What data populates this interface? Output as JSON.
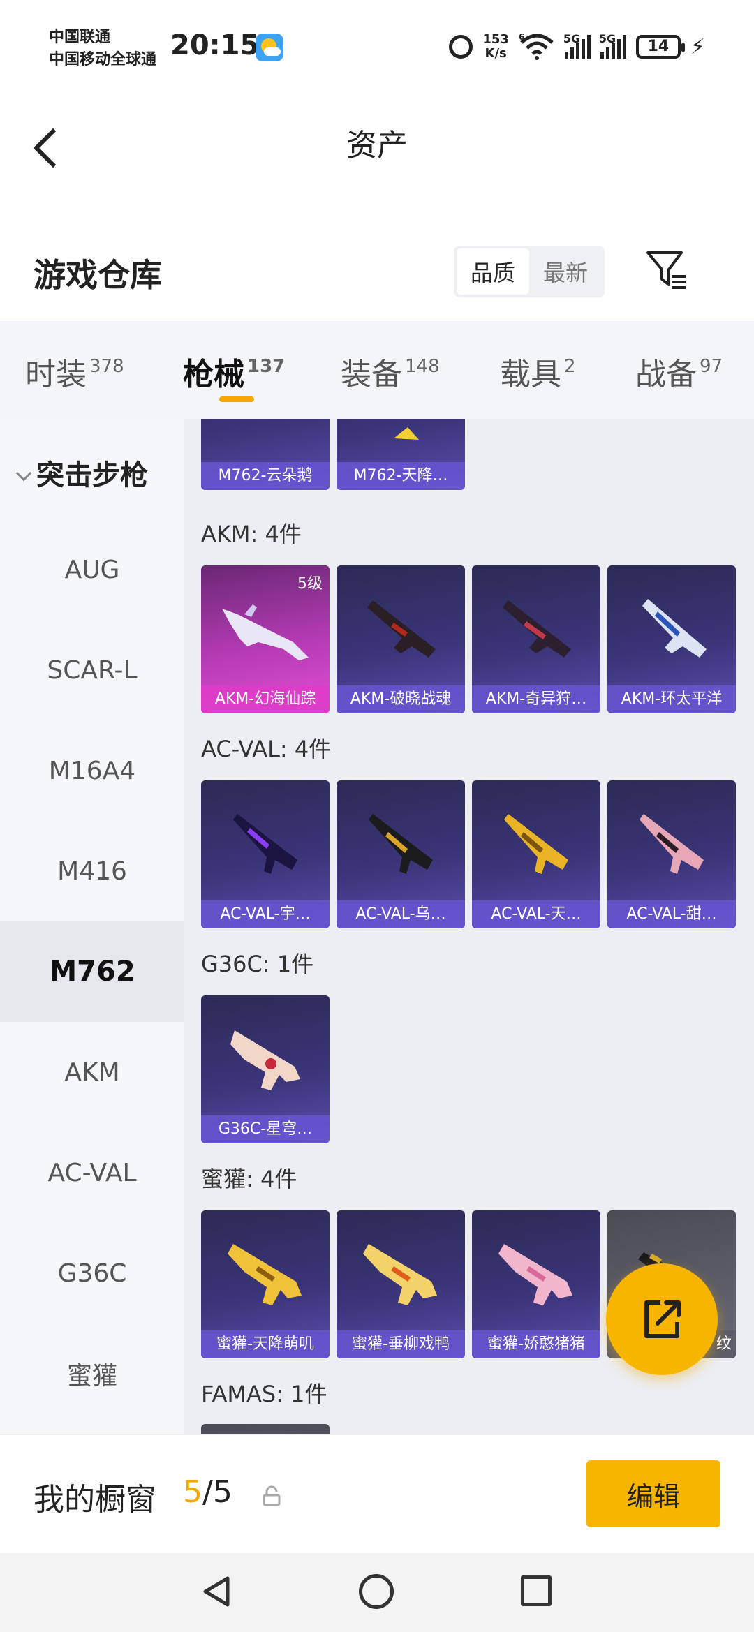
{
  "status_bar": {
    "carrier1": "中国联通",
    "carrier2": "中国移动全球通",
    "time": "20:15",
    "net_speed_value": "153",
    "net_speed_unit": "K/s",
    "signal1_label": "5G",
    "signal2_label": "5G",
    "battery": "14",
    "wifi_tag": "6"
  },
  "header": {
    "title": "资产"
  },
  "warehouse": {
    "title": "游戏仓库",
    "sort_options": [
      "品质",
      "最新"
    ],
    "sort_active": "品质"
  },
  "tabs": [
    {
      "label": "时装",
      "count": "378"
    },
    {
      "label": "枪械",
      "count": "137",
      "active": true
    },
    {
      "label": "装备",
      "count": "148"
    },
    {
      "label": "载具",
      "count": "2"
    },
    {
      "label": "战备",
      "count": "97"
    }
  ],
  "subcategory": {
    "group": "突击步枪",
    "items": [
      "AUG",
      "SCAR-L",
      "M16A4",
      "M416",
      "M762",
      "AKM",
      "AC-VAL",
      "G36C",
      "蜜獾"
    ],
    "active": "M762"
  },
  "sections": [
    {
      "title": "",
      "items": [
        "M762-云朵鹅",
        "M762-天降…"
      ]
    },
    {
      "title": "AKM: 4件",
      "items": [
        "AKM-幻海仙踪",
        "AKM-破晓战魂",
        "AKM-奇异狩…",
        "AKM-环太平洋"
      ],
      "first_level": "5级"
    },
    {
      "title": "AC-VAL: 4件",
      "items": [
        "AC-VAL-宇…",
        "AC-VAL-乌…",
        "AC-VAL-天…",
        "AC-VAL-甜…"
      ]
    },
    {
      "title": "G36C: 1件",
      "items": [
        "G36C-星穹…"
      ]
    },
    {
      "title": "蜜獾: 4件",
      "items": [
        "蜜獾-天降萌叽",
        "蜜獾-垂柳戏鸭",
        "蜜獾-娇憨猪猪",
        "纹"
      ]
    },
    {
      "title": "FAMAS: 1件",
      "items": []
    }
  ],
  "showcase": {
    "title": "我的橱窗",
    "count_current": "5",
    "count_total": "/5",
    "edit_label": "编辑"
  },
  "colors": {
    "accent": "#f5a800",
    "card_bg": "#3a3478",
    "card_label": "#6656d2",
    "legendary": "#e24fd6"
  }
}
